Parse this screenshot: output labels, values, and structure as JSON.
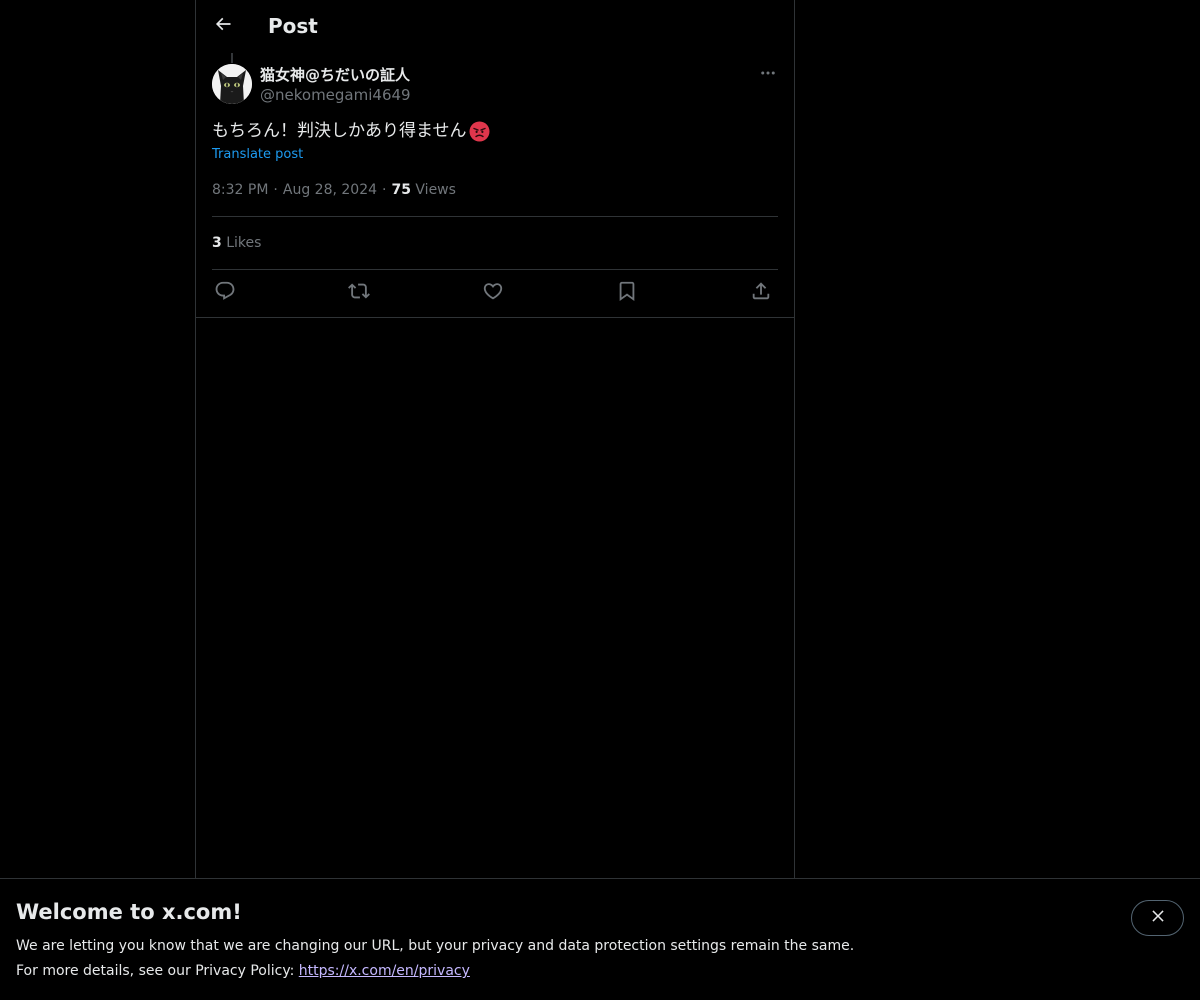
{
  "header": {
    "back_icon": "arrow-left-icon",
    "title": "Post"
  },
  "post": {
    "author_name": "猫女神@ちだいの証人",
    "author_handle": "@nekomegami4649",
    "avatar": "black-cat-avatar",
    "more_icon": "more-horizontal-icon",
    "text": "もちろん！判決しかあり得ません",
    "emoji": "angry-face-emoji",
    "translate_label": "Translate post",
    "time": "8:32 PM",
    "separator": "·",
    "date": "Aug 28, 2024",
    "views_count": "75",
    "views_label": "Views",
    "likes_count": "3",
    "likes_label": "Likes"
  },
  "actions": [
    {
      "name": "reply",
      "icon": "reply-icon"
    },
    {
      "name": "repost",
      "icon": "repost-icon"
    },
    {
      "name": "like",
      "icon": "heart-icon"
    },
    {
      "name": "bookmark",
      "icon": "bookmark-icon"
    },
    {
      "name": "share",
      "icon": "share-icon"
    }
  ],
  "banner": {
    "title": "Welcome to x.com!",
    "line1": "We are letting you know that we are changing our URL, but your privacy and data protection settings remain the same.",
    "line2_prefix": "For more details, see our Privacy Policy: ",
    "privacy_link": "https://x.com/en/privacy",
    "close_icon": "close-icon"
  },
  "colors": {
    "background": "#000000",
    "text_primary": "#e7e9ea",
    "text_secondary": "#71767b",
    "accent": "#1d9bf0",
    "border": "#2f3336",
    "link_visited": "#c5b8ff"
  }
}
